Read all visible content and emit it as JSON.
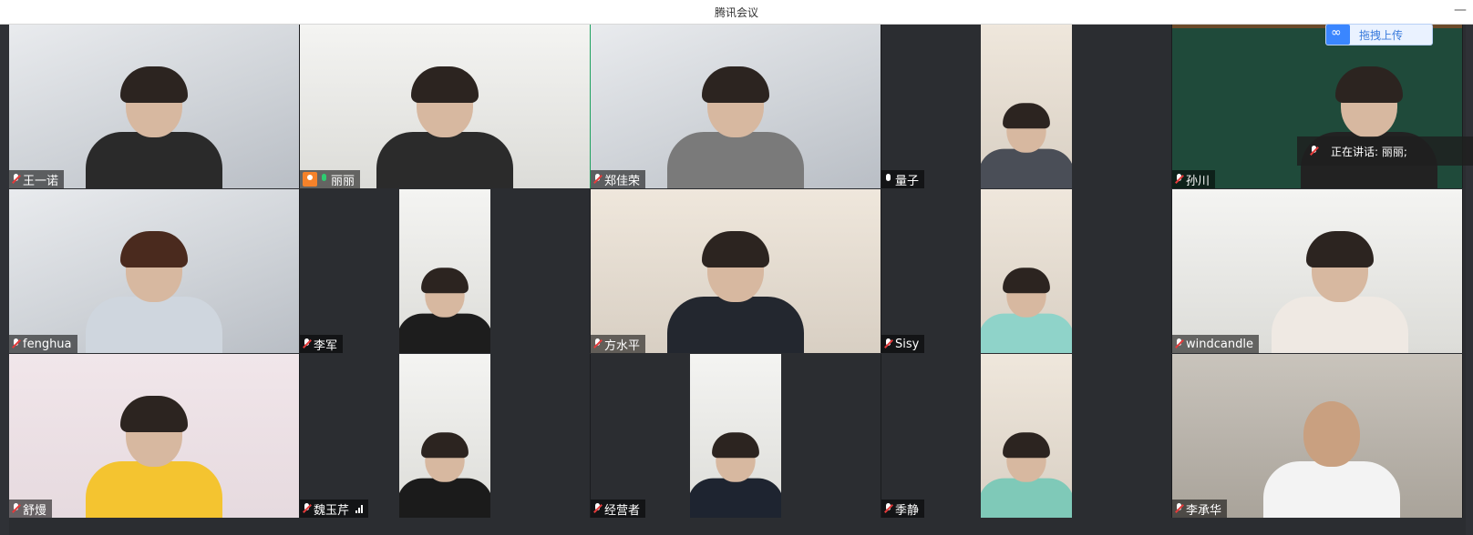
{
  "window": {
    "title": "腾讯会议",
    "minimize_glyph": "—"
  },
  "upload_button": {
    "label": "拖拽上传",
    "icon": "baidu-netdisk-icon"
  },
  "speaking_indicator": {
    "text": "正在讲话: 丽丽;",
    "icon": "speaker-mic-icon"
  },
  "colors": {
    "active_speaker_border": "#1ea15f",
    "muted": "#e43b3b",
    "host": "#f5822a"
  },
  "participants": [
    {
      "name": "王一诺",
      "mic": "muted"
    },
    {
      "name": "丽丽",
      "mic": "active",
      "host": true
    },
    {
      "name": "郑佳荣",
      "mic": "muted"
    },
    {
      "name": "量子",
      "mic": "on"
    },
    {
      "name": "孙川",
      "mic": "muted"
    },
    {
      "name": "fenghua",
      "mic": "muted"
    },
    {
      "name": "李军",
      "mic": "muted"
    },
    {
      "name": "方水平",
      "mic": "muted"
    },
    {
      "name": "Sisy",
      "mic": "muted"
    },
    {
      "name": "windcandle",
      "mic": "muted"
    },
    {
      "name": "舒熳",
      "mic": "muted"
    },
    {
      "name": "魏玉芹",
      "mic": "muted",
      "signal": true
    },
    {
      "name": "经营者",
      "mic": "muted"
    },
    {
      "name": "季静",
      "mic": "muted"
    },
    {
      "name": "李承华",
      "mic": "muted"
    }
  ]
}
